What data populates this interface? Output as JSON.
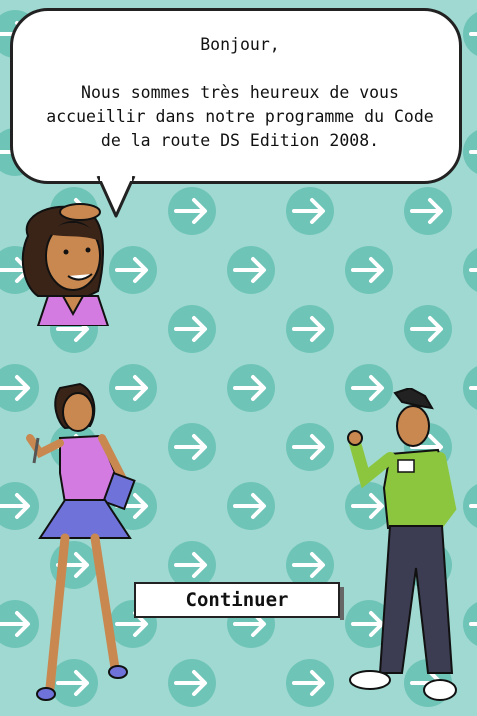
{
  "dialog": {
    "text": "Bonjour,\n\nNous sommes très heureux de vous accueillir dans notre programme du Code de la route DS Edition 2008."
  },
  "buttons": {
    "continue_label": "Continuer"
  },
  "colors": {
    "background": "#9fd9d1",
    "arrow_circle": "#6fc4b8",
    "arrow": "#ffffff",
    "woman_top": "#d37be0",
    "woman_skirt": "#6f73d9",
    "man_shirt": "#8cc63f",
    "man_pants": "#3c3d52"
  },
  "icons": [
    "arrow-right-icon"
  ]
}
